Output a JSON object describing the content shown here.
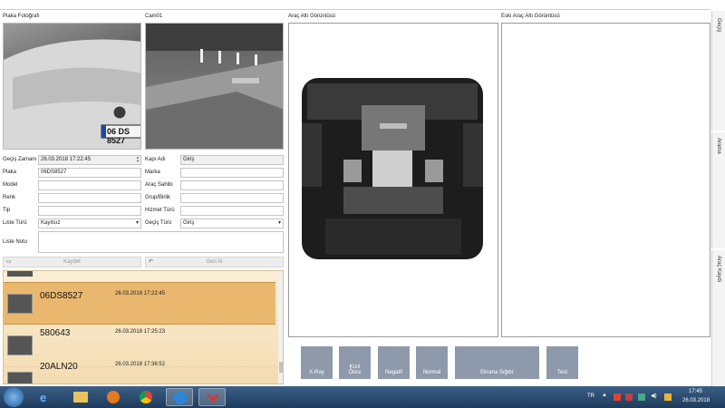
{
  "panels": {
    "plate_photo_title": "Plaka Fotoğrafı",
    "camera_title": "Cam01",
    "undercarriage_title": "Araç Altı Görüntüsü",
    "old_undercarriage_title": "Eski Araç Altı Görüntüsü"
  },
  "photo": {
    "plate_text": "06 DS 8527"
  },
  "form": {
    "pass_time_label": "Geçiş Zamanı",
    "pass_time_value": "26.03.2018 17:22:45",
    "plate_label": "Plaka",
    "plate_value": "06DS8527",
    "model_label": "Model",
    "model_value": "",
    "color_label": "Renk",
    "color_value": "",
    "type_label": "Tip",
    "type_value": "",
    "list_type_label": "Liste Türü",
    "list_type_value": "Kayıtsız",
    "list_note_label": "Liste Notu",
    "list_note_value": "",
    "gate_label": "Kapı Adı",
    "gate_value": "Giriş",
    "brand_label": "Marka",
    "brand_value": "",
    "owner_label": "Araç Sahibi",
    "owner_value": "",
    "group_label": "Grup/Birlik",
    "group_value": "",
    "service_label": "Hizmet Türü",
    "service_value": "",
    "pass_type_label": "Geçiş Türü",
    "pass_type_value": "Giriş"
  },
  "toolbar": {
    "save_label": "Kaydet",
    "undo_label": "Geri Al"
  },
  "records": [
    {
      "plate": "06DS8527",
      "datetime": "26.03.2018 17:22:45",
      "selected": true
    },
    {
      "plate": "580643",
      "datetime": "26.03.2018 17:25:23",
      "selected": false
    },
    {
      "plate": "20ALN20",
      "datetime": "26.03.2018 17:36:52",
      "selected": false
    }
  ],
  "view_buttons": {
    "xray": "X-Ray",
    "infrared_line1": "Kızıl",
    "infrared_line2": "Ötesi",
    "negative": "Negatif",
    "normal": "Normal",
    "fit_screen": "Ekrana Sığdır",
    "test": "Test"
  },
  "side_tabs": {
    "pass": "Geçiş",
    "search": "Arama",
    "vehicle_record": "Araç Kaydı"
  },
  "taskbar": {
    "language": "TR",
    "time": "17:45",
    "date": "26.03.2018"
  },
  "colors": {
    "selected_row": "#e9b86e",
    "list_bg": "#f6e3c1",
    "view_button": "#8e9aab",
    "taskbar": "#2a4a6e"
  }
}
